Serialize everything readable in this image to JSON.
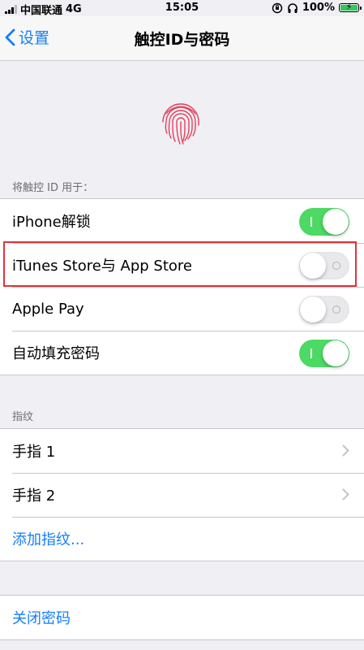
{
  "status_bar": {
    "carrier": "中国联通",
    "network": "4G",
    "time": "15:05",
    "battery": "100%"
  },
  "nav": {
    "back_label": "设置",
    "title": "触控ID与密码"
  },
  "touch_id_section": {
    "header": "将触控 ID 用于：",
    "items": [
      {
        "label": "iPhone解锁",
        "toggle": "on"
      },
      {
        "label": "iTunes Store与 App Store",
        "toggle": "off"
      },
      {
        "label": "Apple Pay",
        "toggle": "off"
      },
      {
        "label": "自动填充密码",
        "toggle": "on"
      }
    ]
  },
  "fingerprints_section": {
    "header": "指纹",
    "items": [
      {
        "label": "手指 1"
      },
      {
        "label": "手指 2"
      }
    ],
    "add_label": "添加指纹..."
  },
  "passcode_section": {
    "turn_off_label": "关闭密码"
  },
  "colors": {
    "accent": "#147efb",
    "toggle_on": "#4cd964",
    "highlight": "#e0333a",
    "fingerprint": "#e5405b"
  }
}
